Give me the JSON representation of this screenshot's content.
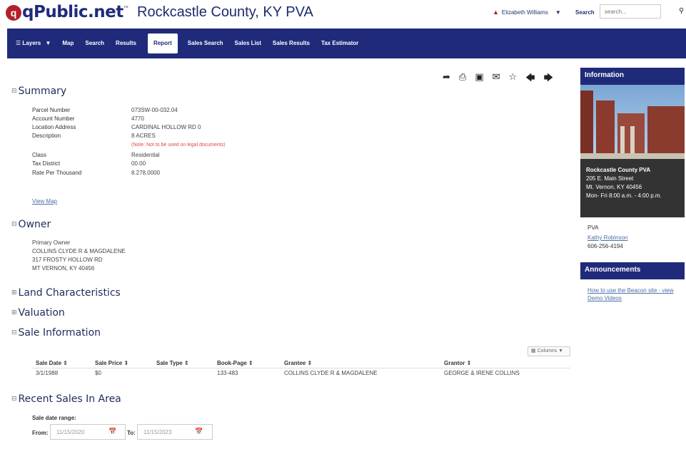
{
  "brand": {
    "mark": "q",
    "name": "qPublic.net",
    "tm": "™"
  },
  "county_title": "Rockcastle County, KY PVA",
  "user": {
    "name": "Elizabeth Williams",
    "search_label": "Search",
    "search_placeholder": "search..."
  },
  "nav": {
    "layers": "Layers",
    "items": [
      "Map",
      "Search",
      "Results",
      "Report",
      "Sales Search",
      "Sales List",
      "Sales Results",
      "Tax Estimator"
    ],
    "active": "Report"
  },
  "summary": {
    "title": "Summary",
    "rows": [
      {
        "label": "Parcel Number",
        "value": "073SW-00-032.04"
      },
      {
        "label": "Account Number",
        "value": "4770"
      },
      {
        "label": "Location Address",
        "value": "CARDINAL HOLLOW RD 0"
      },
      {
        "label": "Description",
        "value": "8 ACRES"
      },
      {
        "label": "Class",
        "value": "Residential"
      },
      {
        "label": "Tax District",
        "value": "00.00"
      },
      {
        "label": "Rate Per Thousand",
        "value": "8.278.0000"
      }
    ],
    "note": "(Note: Not to be used on legal documents)",
    "view_map": "View Map"
  },
  "owner": {
    "title": "Owner",
    "lines": [
      "Primary Owner",
      "COLLINS CLYDE R & MAGDALENE",
      "317 FROSTY HOLLOW RD",
      "MT VERNON, KY 40456"
    ]
  },
  "sections": {
    "land": "Land Characteristics",
    "valuation": "Valuation",
    "sale": "Sale Information",
    "recent": "Recent Sales In Area"
  },
  "sale_table": {
    "columns_btn": "Columns",
    "headers": [
      "Sale Date",
      "Sale Price",
      "Sale Type",
      "Book-Page",
      "Grantee",
      "Grantor"
    ],
    "rows": [
      [
        "3/1/1988",
        "$0",
        "",
        "133-483",
        "COLLINS CLYDE R & MAGDALENE",
        "GEORGE & IRENE COLLINS"
      ]
    ]
  },
  "recent_sales": {
    "range_label": "Sale date range:",
    "from_label": "From:",
    "from_value": "11/15/2020",
    "to_label": "To:",
    "to_value": "11/15/2023"
  },
  "sidebar": {
    "info_title": "Information",
    "office": {
      "name": "Rockcastle County PVA",
      "street": "205 E. Main Street",
      "city": "Mt. Vernon, KY 40456",
      "hours": "Mon- Fri 8:00 a.m. - 4:00 p.m."
    },
    "pva_label": "PVA",
    "pva_name": "Kathy Robinson",
    "phone": "606-256-4194",
    "announcements_title": "Announcements",
    "announcement_link": "How to use the Beacon site - view Demo Videos"
  }
}
